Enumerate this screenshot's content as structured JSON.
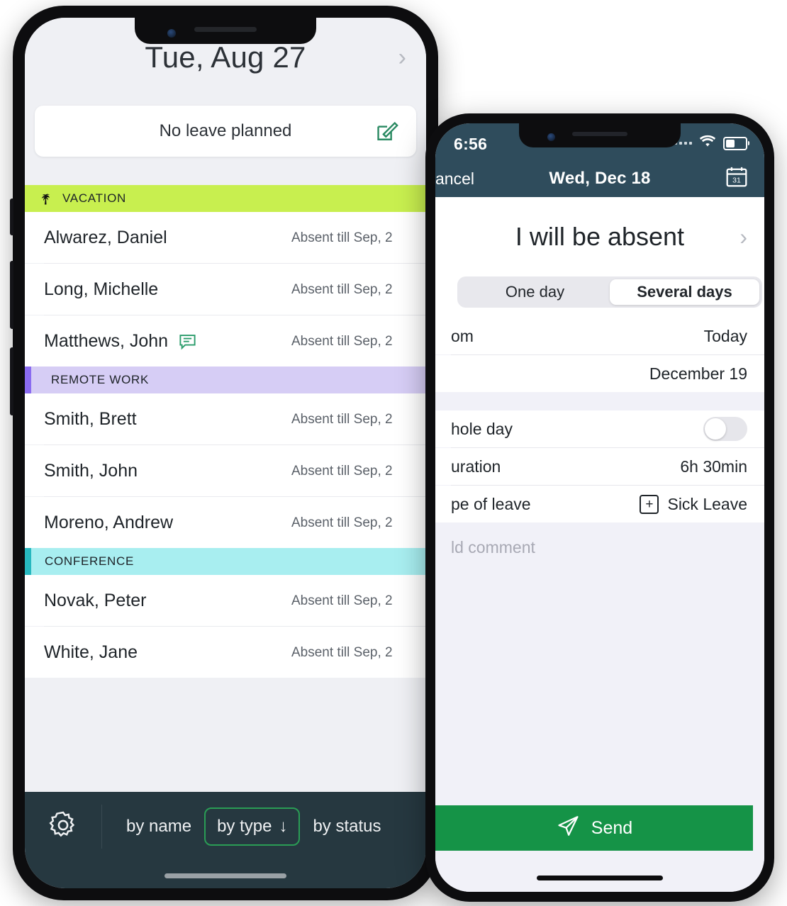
{
  "phone1": {
    "header": {
      "date": "Tue, Aug 27",
      "chevron": "chevron-right-icon"
    },
    "leave_card": {
      "text": "No leave planned",
      "edit_icon": "edit-pencil-icon"
    },
    "sections": [
      {
        "label": "VACATION",
        "icon": "palm-tree-icon",
        "bg": "#c8ef4f",
        "bar": "#c8ef4f",
        "people": [
          {
            "name": "Alwarez, Daniel",
            "status": "Absent till Sep, 2",
            "has_comment": false
          },
          {
            "name": "Long, Michelle",
            "status": "Absent till Sep, 2",
            "has_comment": false
          },
          {
            "name": "Matthews, John",
            "status": "Absent till Sep, 2",
            "has_comment": true
          }
        ]
      },
      {
        "label": "REMOTE WORK",
        "icon": "",
        "bg": "#d6cdf5",
        "bar": "#8a6bf0",
        "people": [
          {
            "name": "Smith, Brett",
            "status": "Absent till Sep, 2",
            "has_comment": false
          },
          {
            "name": "Smith, John",
            "status": "Absent till Sep, 2",
            "has_comment": false
          },
          {
            "name": "Moreno, Andrew",
            "status": "Absent till Sep, 2",
            "has_comment": false
          }
        ]
      },
      {
        "label": "CONFERENCE",
        "icon": "",
        "bg": "#a8eef0",
        "bar": "#27b8bf",
        "people": [
          {
            "name": "Novak, Peter",
            "status": "Absent till Sep, 2",
            "has_comment": false
          },
          {
            "name": "White, Jane",
            "status": "Absent till Sep, 2",
            "has_comment": false
          }
        ]
      }
    ],
    "tabbar": {
      "settings_icon": "gear-icon",
      "tabs": [
        {
          "label": "by name",
          "selected": false
        },
        {
          "label": "by type",
          "selected": true,
          "arrow": "↓"
        },
        {
          "label": "by status",
          "selected": false
        }
      ]
    }
  },
  "phone2": {
    "status_bar": {
      "time": "6:56",
      "signal_icon": "signal-dots-icon",
      "wifi_icon": "wifi-icon",
      "battery_icon": "battery-icon"
    },
    "nav": {
      "cancel_label": "ancel",
      "title": "Wed, Dec 18",
      "calendar_icon": "calendar-31-icon"
    },
    "page_title": "I will be absent",
    "page_title_chevron": "chevron-right-icon",
    "segmented": [
      {
        "label": "One day",
        "selected": false
      },
      {
        "label": "Several days",
        "selected": true
      }
    ],
    "fields": [
      {
        "label": "om",
        "value": "Today",
        "type": "text"
      },
      {
        "label": "",
        "value": "December 19",
        "type": "text"
      },
      {
        "label": "hole day",
        "value": "",
        "type": "toggle",
        "toggle_on": false
      },
      {
        "label": "uration",
        "value": "6h 30min",
        "type": "text"
      },
      {
        "label": "pe of leave",
        "value": "Sick Leave",
        "type": "plus",
        "plus_icon": "plus-box-icon"
      }
    ],
    "comment_placeholder": "ld comment",
    "send": {
      "label": "Send",
      "icon": "paper-plane-icon",
      "color": "#159347"
    }
  },
  "colors": {
    "accent_green": "#159347",
    "navbar_dark": "#263840",
    "status_navy": "#2f4c5c",
    "screen_bg": "#eff0f4"
  }
}
